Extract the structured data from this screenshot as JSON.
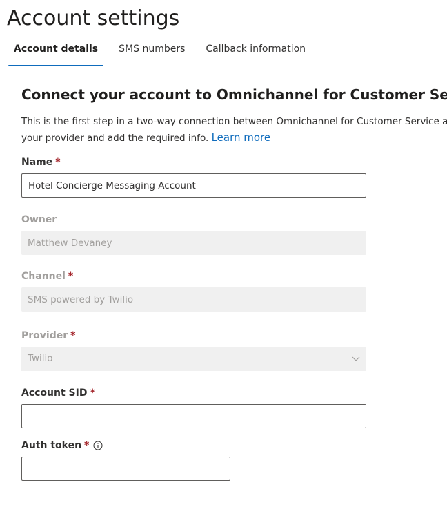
{
  "page": {
    "title": "Account settings"
  },
  "tabs": [
    {
      "label": "Account details",
      "active": true
    },
    {
      "label": "SMS numbers",
      "active": false
    },
    {
      "label": "Callback information",
      "active": false
    }
  ],
  "section": {
    "title": "Connect your account to Omnichannel for Customer Service",
    "desc_line1": "This is the first step in a two-way connection between Omnichannel for Customer Service a",
    "desc_line2": "your provider and add the required info.",
    "learn_more": "Learn more"
  },
  "form": {
    "required_marker": "*",
    "name": {
      "label": "Name",
      "value": "Hotel Concierge Messaging Account"
    },
    "owner": {
      "label": "Owner",
      "value": "Matthew Devaney"
    },
    "channel": {
      "label": "Channel",
      "value": "SMS powered by Twilio"
    },
    "provider": {
      "label": "Provider",
      "value": "Twilio"
    },
    "account_sid": {
      "label": "Account SID",
      "value": ""
    },
    "auth_token": {
      "label": "Auth token",
      "value": ""
    }
  },
  "icons": {
    "provider_dropdown": "chevron-down-icon",
    "auth_token_info": "info-icon"
  },
  "colors": {
    "accent": "#0f6cbd",
    "required": "#a4262c",
    "disabled_bg": "#f0f0f0",
    "disabled_text": "#a19f9d"
  }
}
